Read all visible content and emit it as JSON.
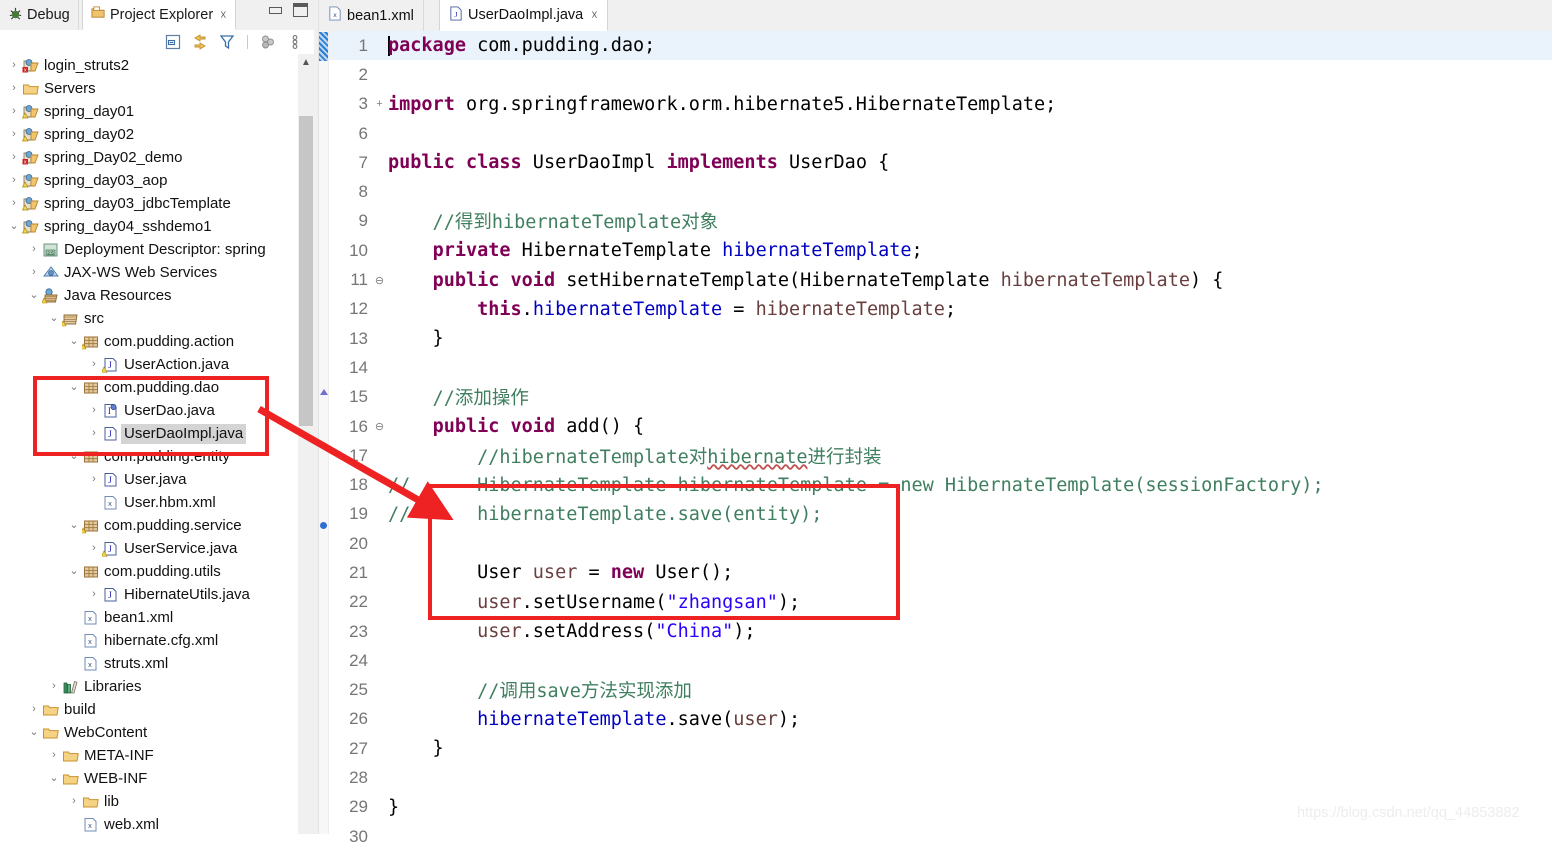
{
  "workbench": {
    "view_tabs": [
      {
        "label": "Debug",
        "icon": "debug-icon",
        "active": false,
        "closable": false
      },
      {
        "label": "Project Explorer",
        "icon": "project-explorer-icon",
        "active": true,
        "closable": true
      }
    ],
    "window_buttons": [
      {
        "name": "minimize-button",
        "label": "Minimize"
      },
      {
        "name": "maximize-button",
        "label": "Maximize"
      }
    ],
    "tree_toolbar": [
      {
        "name": "collapse-all-icon",
        "label": "Collapse All"
      },
      {
        "name": "link-with-editor-icon",
        "label": "Link with Editor"
      },
      {
        "name": "filter-icon",
        "label": "Filters"
      },
      {
        "name": "view-menu-icon",
        "label": "View Menu"
      }
    ]
  },
  "tree": {
    "items": [
      {
        "label": "login_struts2",
        "indent": 0,
        "twisty": "collapsed",
        "icon": "project-error-icon"
      },
      {
        "label": "Servers",
        "indent": 0,
        "twisty": "collapsed",
        "icon": "folder-icon"
      },
      {
        "label": "spring_day01",
        "indent": 0,
        "twisty": "collapsed",
        "icon": "project-warn-icon"
      },
      {
        "label": "spring_day02",
        "indent": 0,
        "twisty": "collapsed",
        "icon": "project-warn-icon"
      },
      {
        "label": "spring_Day02_demo",
        "indent": 0,
        "twisty": "collapsed",
        "icon": "project-error-icon"
      },
      {
        "label": "spring_day03_aop",
        "indent": 0,
        "twisty": "collapsed",
        "icon": "project-warn-icon"
      },
      {
        "label": "spring_day03_jdbcTemplate",
        "indent": 0,
        "twisty": "collapsed",
        "icon": "project-warn-icon"
      },
      {
        "label": "spring_day04_sshdemo1",
        "indent": 0,
        "twisty": "expanded",
        "icon": "project-warn-icon"
      },
      {
        "label": "Deployment Descriptor: spring",
        "indent": 1,
        "twisty": "collapsed",
        "icon": "deployment-descriptor-icon"
      },
      {
        "label": "JAX-WS Web Services",
        "indent": 1,
        "twisty": "collapsed",
        "icon": "jaxws-icon"
      },
      {
        "label": "Java Resources",
        "indent": 1,
        "twisty": "expanded",
        "icon": "java-resources-icon"
      },
      {
        "label": "src",
        "indent": 2,
        "twisty": "expanded",
        "icon": "source-folder-icon"
      },
      {
        "label": "com.pudding.action",
        "indent": 3,
        "twisty": "expanded",
        "icon": "package-warn-icon"
      },
      {
        "label": "UserAction.java",
        "indent": 4,
        "twisty": "collapsed",
        "icon": "java-file-warn-icon"
      },
      {
        "label": "com.pudding.dao",
        "indent": 3,
        "twisty": "expanded",
        "icon": "package-icon"
      },
      {
        "label": "UserDao.java",
        "indent": 4,
        "twisty": "collapsed",
        "icon": "java-interface-icon"
      },
      {
        "label": "UserDaoImpl.java",
        "indent": 4,
        "twisty": "collapsed",
        "icon": "java-file-icon",
        "selected": true
      },
      {
        "label": "com.pudding.entity",
        "indent": 3,
        "twisty": "expanded",
        "icon": "package-icon"
      },
      {
        "label": "User.java",
        "indent": 4,
        "twisty": "collapsed",
        "icon": "java-file-icon"
      },
      {
        "label": "User.hbm.xml",
        "indent": 4,
        "twisty": "none",
        "icon": "xml-file-icon"
      },
      {
        "label": "com.pudding.service",
        "indent": 3,
        "twisty": "expanded",
        "icon": "package-warn-icon"
      },
      {
        "label": "UserService.java",
        "indent": 4,
        "twisty": "collapsed",
        "icon": "java-file-warn-icon"
      },
      {
        "label": "com.pudding.utils",
        "indent": 3,
        "twisty": "expanded",
        "icon": "package-icon"
      },
      {
        "label": "HibernateUtils.java",
        "indent": 4,
        "twisty": "collapsed",
        "icon": "java-file-icon"
      },
      {
        "label": "bean1.xml",
        "indent": 3,
        "twisty": "none",
        "icon": "xml-file-icon"
      },
      {
        "label": "hibernate.cfg.xml",
        "indent": 3,
        "twisty": "none",
        "icon": "xml-file-icon"
      },
      {
        "label": "struts.xml",
        "indent": 3,
        "twisty": "none",
        "icon": "xml-file-icon"
      },
      {
        "label": "Libraries",
        "indent": 2,
        "twisty": "collapsed",
        "icon": "libraries-icon"
      },
      {
        "label": "build",
        "indent": 1,
        "twisty": "collapsed",
        "icon": "folder-icon"
      },
      {
        "label": "WebContent",
        "indent": 1,
        "twisty": "expanded",
        "icon": "folder-icon"
      },
      {
        "label": "META-INF",
        "indent": 2,
        "twisty": "collapsed",
        "icon": "folder-icon"
      },
      {
        "label": "WEB-INF",
        "indent": 2,
        "twisty": "expanded",
        "icon": "folder-icon"
      },
      {
        "label": "lib",
        "indent": 3,
        "twisty": "collapsed",
        "icon": "folder-icon"
      },
      {
        "label": "web.xml",
        "indent": 3,
        "twisty": "none",
        "icon": "xml-file-icon"
      }
    ]
  },
  "editor": {
    "tabs": [
      {
        "label": "bean1.xml",
        "icon": "xml-file-icon",
        "active": false,
        "closable": false
      },
      {
        "label": "UserDaoImpl.java",
        "icon": "java-file-icon",
        "active": true,
        "closable": true
      }
    ],
    "file_name": "UserDaoImpl.java",
    "lines": [
      {
        "num": "1",
        "fold": "",
        "current": true,
        "tokens": [
          {
            "t": "package",
            "c": "k"
          },
          {
            "t": " com.pudding.dao;",
            "c": "pl"
          }
        ]
      },
      {
        "num": "2",
        "fold": "",
        "tokens": []
      },
      {
        "num": "3",
        "fold": "+",
        "tokens": [
          {
            "t": "import",
            "c": "k"
          },
          {
            "t": " org.springframework.orm.hibernate5.HibernateTemplate;",
            "c": "pl"
          }
        ]
      },
      {
        "num": "6",
        "fold": "",
        "tokens": []
      },
      {
        "num": "7",
        "fold": "",
        "tokens": [
          {
            "t": "public",
            "c": "k"
          },
          {
            "t": " ",
            "c": "pl"
          },
          {
            "t": "class",
            "c": "k"
          },
          {
            "t": " UserDaoImpl ",
            "c": "pl"
          },
          {
            "t": "implements",
            "c": "k"
          },
          {
            "t": " UserDao {",
            "c": "pl"
          }
        ]
      },
      {
        "num": "8",
        "fold": "",
        "tokens": []
      },
      {
        "num": "9",
        "fold": "",
        "tokens": [
          {
            "t": "    //得到hibernateTemplate对象",
            "c": "cm"
          }
        ]
      },
      {
        "num": "10",
        "fold": "",
        "tokens": [
          {
            "t": "    ",
            "c": "pl"
          },
          {
            "t": "private",
            "c": "k"
          },
          {
            "t": " HibernateTemplate ",
            "c": "pl"
          },
          {
            "t": "hibernateTemplate",
            "c": "fl"
          },
          {
            "t": ";",
            "c": "pl"
          }
        ]
      },
      {
        "num": "11",
        "fold": "⊖",
        "tokens": [
          {
            "t": "    ",
            "c": "pl"
          },
          {
            "t": "public",
            "c": "k"
          },
          {
            "t": " ",
            "c": "pl"
          },
          {
            "t": "void",
            "c": "k"
          },
          {
            "t": " setHibernateTemplate(HibernateTemplate ",
            "c": "pl"
          },
          {
            "t": "hibernateTemplate",
            "c": "pm"
          },
          {
            "t": ") {",
            "c": "pl"
          }
        ]
      },
      {
        "num": "12",
        "fold": "",
        "tokens": [
          {
            "t": "        ",
            "c": "pl"
          },
          {
            "t": "this",
            "c": "k"
          },
          {
            "t": ".",
            "c": "pl"
          },
          {
            "t": "hibernateTemplate",
            "c": "fl"
          },
          {
            "t": " = ",
            "c": "pl"
          },
          {
            "t": "hibernateTemplate",
            "c": "pm"
          },
          {
            "t": ";",
            "c": "pl"
          }
        ]
      },
      {
        "num": "13",
        "fold": "",
        "tokens": [
          {
            "t": "    }",
            "c": "pl"
          }
        ]
      },
      {
        "num": "14",
        "fold": "",
        "tokens": []
      },
      {
        "num": "15",
        "fold": "",
        "tokens": [
          {
            "t": "    //添加操作",
            "c": "cm"
          }
        ]
      },
      {
        "num": "16",
        "fold": "⊖",
        "warning": true,
        "tokens": [
          {
            "t": "    ",
            "c": "pl"
          },
          {
            "t": "public",
            "c": "k"
          },
          {
            "t": " ",
            "c": "pl"
          },
          {
            "t": "void",
            "c": "k"
          },
          {
            "t": " add() {",
            "c": "pl"
          }
        ]
      },
      {
        "num": "17",
        "fold": "",
        "tokens": [
          {
            "t": "        //hibernateTemplate对",
            "c": "cm"
          },
          {
            "t": "hibernate",
            "c": "cm sq"
          },
          {
            "t": "进行封装",
            "c": "cm"
          }
        ]
      },
      {
        "num": "18",
        "fold": "",
        "tokens": [
          {
            "t": "//      HibernateTemplate hibernateTemplate = new HibernateTemplate(sessionFactory);",
            "c": "cm"
          }
        ]
      },
      {
        "num": "19",
        "fold": "",
        "tokens": [
          {
            "t": "//      hibernateTemplate.save(entity);",
            "c": "cm"
          }
        ]
      },
      {
        "num": "20",
        "fold": "",
        "tokens": []
      },
      {
        "num": "21",
        "fold": "",
        "breakpoint": true,
        "tokens": [
          {
            "t": "        User ",
            "c": "pl"
          },
          {
            "t": "user",
            "c": "pm"
          },
          {
            "t": " = ",
            "c": "pl"
          },
          {
            "t": "new",
            "c": "k"
          },
          {
            "t": " User();",
            "c": "pl"
          }
        ]
      },
      {
        "num": "22",
        "fold": "",
        "tokens": [
          {
            "t": "        ",
            "c": "pl"
          },
          {
            "t": "user",
            "c": "pm"
          },
          {
            "t": ".setUsername(",
            "c": "pl"
          },
          {
            "t": "\"zhangsan\"",
            "c": "st"
          },
          {
            "t": ");",
            "c": "pl"
          }
        ]
      },
      {
        "num": "23",
        "fold": "",
        "tokens": [
          {
            "t": "        ",
            "c": "pl"
          },
          {
            "t": "user",
            "c": "pm"
          },
          {
            "t": ".setAddress(",
            "c": "pl"
          },
          {
            "t": "\"China\"",
            "c": "st"
          },
          {
            "t": ");",
            "c": "pl"
          }
        ]
      },
      {
        "num": "24",
        "fold": "",
        "tokens": []
      },
      {
        "num": "25",
        "fold": "",
        "tokens": [
          {
            "t": "        //调用save方法实现添加",
            "c": "cm"
          }
        ]
      },
      {
        "num": "26",
        "fold": "",
        "tokens": [
          {
            "t": "        ",
            "c": "pl"
          },
          {
            "t": "hibernateTemplate",
            "c": "fl"
          },
          {
            "t": ".save(",
            "c": "pl"
          },
          {
            "t": "user",
            "c": "pm"
          },
          {
            "t": ");",
            "c": "pl"
          }
        ]
      },
      {
        "num": "27",
        "fold": "",
        "tokens": [
          {
            "t": "    }",
            "c": "pl"
          }
        ]
      },
      {
        "num": "28",
        "fold": "",
        "tokens": []
      },
      {
        "num": "29",
        "fold": "",
        "tokens": [
          {
            "t": "}",
            "c": "pl"
          }
        ]
      },
      {
        "num": "30",
        "fold": "",
        "tokens": []
      }
    ]
  },
  "annotations": {
    "box_tree_target": "com.pudding.dao package with UserDao.java and UserDaoImpl.java",
    "box_code_target": "User object creation block, lines 21-23",
    "arrow_color": "#ee2222",
    "box_color": "#ee2222"
  },
  "watermark": {
    "text": "https://blog.csdn.net/qq_44853882"
  },
  "colors": {
    "keyword": "#7f0055",
    "comment": "#3f7f5f",
    "field": "#0000c0",
    "string": "#2a00ff",
    "parameter": "#6a3e3e",
    "annotation_red": "#ee2222",
    "current_line": "#eaf2fb",
    "selection": "#d4d4d4"
  }
}
